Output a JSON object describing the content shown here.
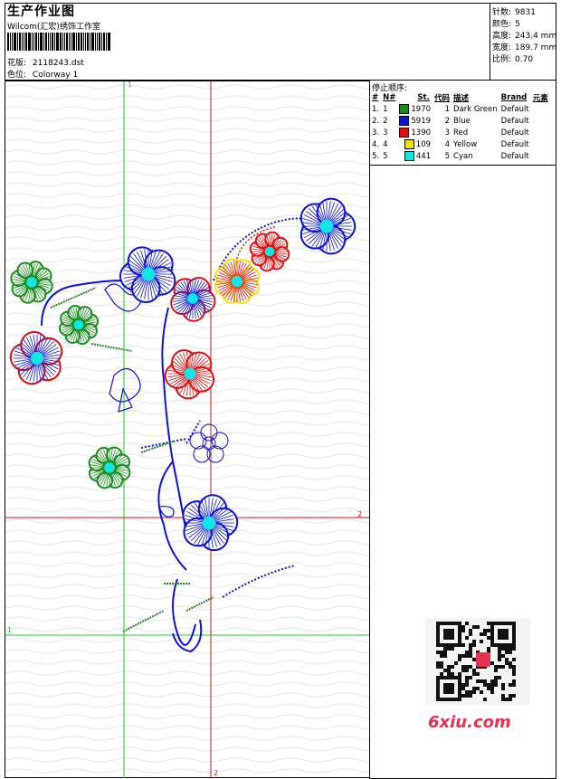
{
  "header": {
    "title": "生产作业图",
    "company": "Wilcom(汇宏)绣饰工作室",
    "design_label": "花版:",
    "design_value": "2118243.dst",
    "colorway_label": "色位:",
    "colorway_value": "Colorway 1"
  },
  "stats": [
    {
      "label": "针数:",
      "value": "9831"
    },
    {
      "label": "颜色:",
      "value": "5"
    },
    {
      "label": "高度:",
      "value": "243.4 mm"
    },
    {
      "label": "宽度:",
      "value": "189.7 mm"
    },
    {
      "label": "比例:",
      "value": "0.70"
    }
  ],
  "stop_sequence": {
    "title": "停止顺序:",
    "columns": [
      "#",
      "N#",
      "St.",
      "代码",
      "描述",
      "Brand",
      "元素"
    ],
    "rows": [
      {
        "idx": "1.",
        "n": "1",
        "color": "#1a8c1a",
        "st": "1970",
        "code": "1",
        "desc": "Dark Green",
        "brand": "Default"
      },
      {
        "idx": "2.",
        "n": "2",
        "color": "#0a14d8",
        "st": "5919",
        "code": "2",
        "desc": "Blue",
        "brand": "Default"
      },
      {
        "idx": "3.",
        "n": "3",
        "color": "#e01010",
        "st": "1390",
        "code": "3",
        "desc": "Red",
        "brand": "Default"
      },
      {
        "idx": "4.",
        "n": "4",
        "color": "#f2e600",
        "st": "109",
        "code": "4",
        "desc": "Yellow",
        "brand": "Default"
      },
      {
        "idx": "5.",
        "n": "5",
        "color": "#10e6e6",
        "st": "441",
        "code": "5",
        "desc": "Cyan",
        "brand": "Default"
      }
    ]
  },
  "guides": {
    "v1": "1",
    "h1": "1",
    "v2": "2",
    "h2": "2"
  },
  "watermark": "6xiu.com",
  "colors": {
    "green": "#1a8c1a",
    "blue": "#0a14d8",
    "red": "#e01010",
    "yellow": "#f2e600",
    "cyan": "#10e6e6",
    "guide_green": "#22cc22",
    "guide_red": "#dd1111"
  }
}
